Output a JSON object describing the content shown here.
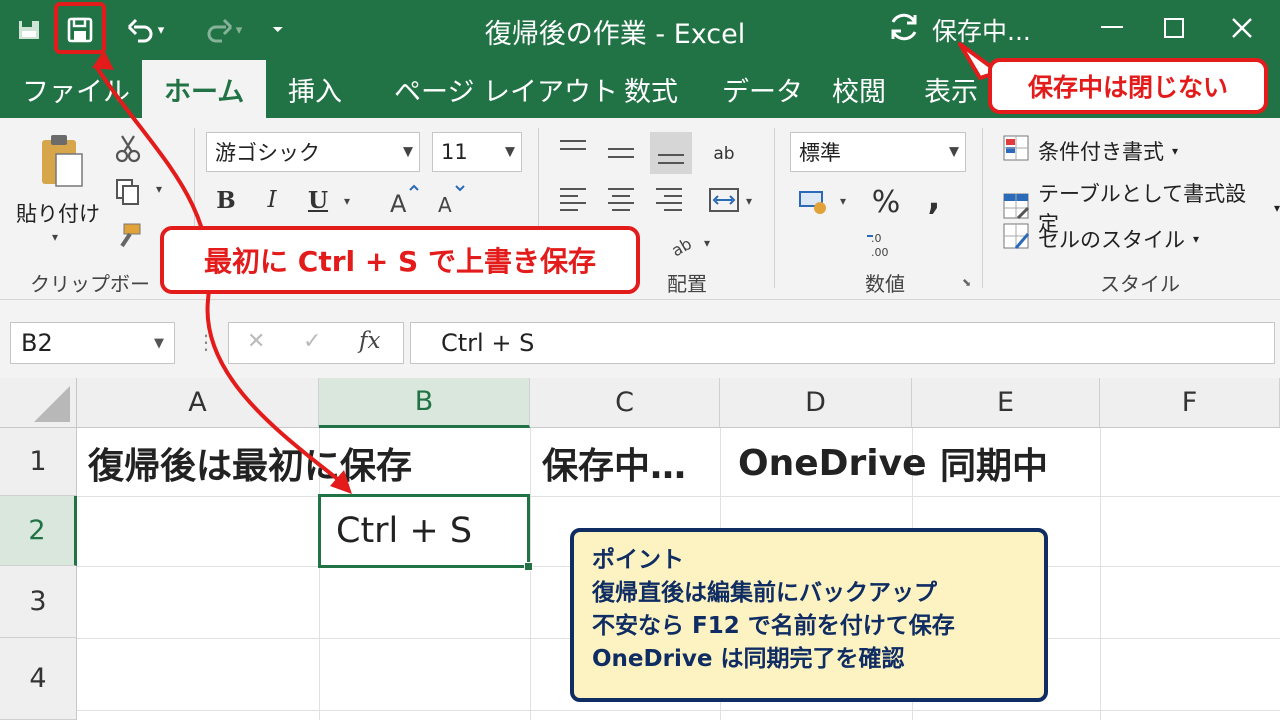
{
  "window": {
    "title": "復帰後の作業 - Excel",
    "save_status": "保存中..."
  },
  "tabs": [
    "ファイル",
    "ホーム",
    "挿入",
    "ページ レイアウト",
    "数式",
    "データ",
    "校閲",
    "表示"
  ],
  "active_tab": "ホーム",
  "ribbon": {
    "paste_label": "貼り付け",
    "clipboard_group": "クリップボード",
    "font_name": "游ゴシック",
    "font_size": "11",
    "bold": "B",
    "italic": "I",
    "underline": "U",
    "align_group": "配置",
    "number_format": "標準",
    "percent": "%",
    "comma": ",",
    "number_group": "数値",
    "conditional_format": "条件付き書式",
    "format_as_table": "テーブルとして書式設定",
    "cell_styles": "セルのスタイル",
    "styles_group": "スタイル"
  },
  "formula_bar": {
    "name_box": "B2",
    "fx": "fx",
    "content": "Ctrl + S"
  },
  "grid": {
    "columns": [
      "A",
      "B",
      "C",
      "D",
      "E",
      "F"
    ],
    "rows": [
      "1",
      "2",
      "3",
      "4"
    ],
    "cells": {
      "A1": "復帰後は最初に保存",
      "C1": "保存中…",
      "D1": "OneDrive",
      "E1": "同期中",
      "B2": "Ctrl + S"
    },
    "selected_cell": "B2"
  },
  "callouts": {
    "top_right": "保存中は閉じない",
    "middle": "最初に Ctrl + S で上書き保存"
  },
  "point_box": {
    "heading": "ポイント",
    "lines": [
      "復帰直後は編集前にバックアップ",
      "不安なら F12 で名前を付けて保存",
      "OneDrive は同期完了を確認"
    ]
  },
  "colors": {
    "excel_green": "#217346",
    "callout_red": "#e31b1b",
    "point_bg": "#fdf3c2",
    "point_border": "#0f2d63"
  }
}
